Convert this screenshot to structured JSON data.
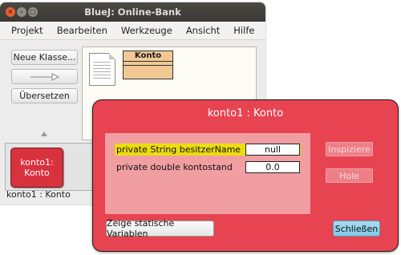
{
  "bluej": {
    "title": "BlueJ:  Online-Bank",
    "window_controls": {
      "close": "×",
      "minimize": "–",
      "maximize": "□"
    },
    "menu": [
      "Projekt",
      "Bearbeiten",
      "Werkzeuge",
      "Ansicht",
      "Hilfe"
    ],
    "buttons": {
      "new_class": "Neue Klasse...",
      "compile": "Übersetzen"
    },
    "class_diagram": {
      "class_name": "Konto",
      "class_color": "#f1c894"
    },
    "object_bench": {
      "object_line1": "konto1:",
      "object_line2": "Konto",
      "object_color": "#d9323f"
    },
    "status": "konto1 : Konto"
  },
  "inspector": {
    "title": "konto1 : Konto",
    "background": "#e84351",
    "fields": [
      {
        "declaration": "private String besitzerName",
        "value": "null",
        "highlighted": true
      },
      {
        "declaration": "private double kontostand",
        "value": "0.0",
        "highlighted": false
      }
    ],
    "buttons": {
      "inspect": "Inspiziere",
      "get": "Hole",
      "show_static": "Zeige statische Variablen",
      "close": "Schließen"
    }
  }
}
